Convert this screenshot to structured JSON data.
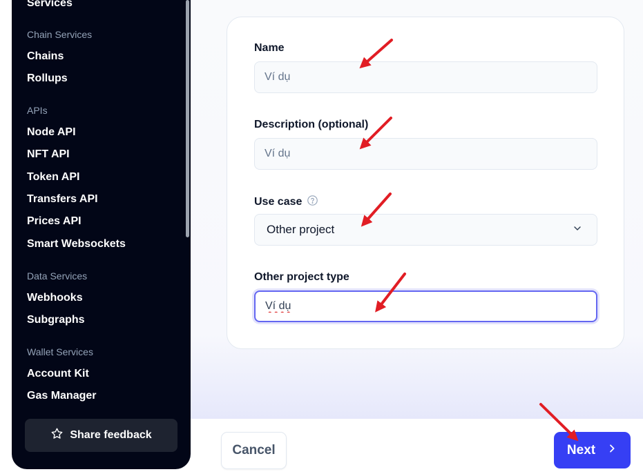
{
  "sidebar": {
    "partial_top_item": "Services",
    "sections": [
      {
        "heading": "Chain Services",
        "items": [
          "Chains",
          "Rollups"
        ]
      },
      {
        "heading": "APIs",
        "items": [
          "Node API",
          "NFT API",
          "Token API",
          "Transfers API",
          "Prices API",
          "Smart Websockets"
        ]
      },
      {
        "heading": "Data Services",
        "items": [
          "Webhooks",
          "Subgraphs"
        ]
      },
      {
        "heading": "Wallet Services",
        "items": [
          "Account Kit",
          "Gas Manager"
        ]
      }
    ],
    "feedback_label": "Share feedback",
    "feedback_icon": "star-outline-icon"
  },
  "form": {
    "name": {
      "label": "Name",
      "placeholder": "Ví dụ"
    },
    "description": {
      "label": "Description (optional)",
      "placeholder": "Ví dụ"
    },
    "use_case": {
      "label": "Use case",
      "help_icon": "question-circle-icon",
      "selected": "Other project",
      "dropdown_icon": "chevron-down-icon"
    },
    "other_project_type": {
      "label": "Other project type",
      "value": "Ví dụ"
    }
  },
  "footer": {
    "cancel_label": "Cancel",
    "next_label": "Next",
    "next_icon": "chevron-right-icon"
  },
  "colors": {
    "sidebar_bg": "#020617",
    "primary": "#363ff4",
    "focus_ring": "#6366f1",
    "annotation_arrow": "#e11d24"
  }
}
